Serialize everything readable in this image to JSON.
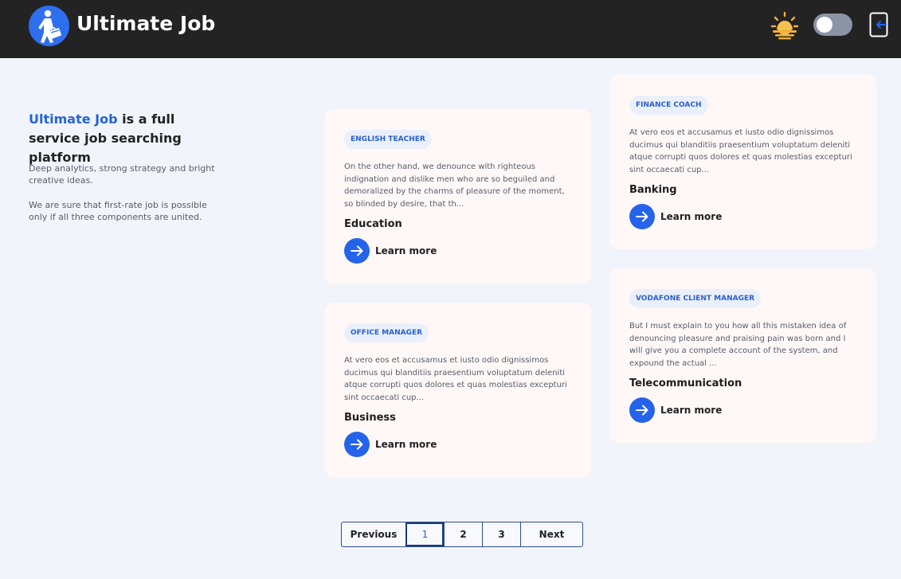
{
  "header": {
    "brand": "Ultimate Job",
    "logo_icon": "worker-with-briefcase-icon",
    "theme_icon": "sunrise-icon",
    "toggle_state": "off",
    "logout_icon": "logout-icon"
  },
  "intro": {
    "brand_highlight": "Ultimate Job",
    "title_rest": " is a full service job searching platform",
    "paragraph1": "Deep analytics, strong strategy and bright creative ideas.",
    "paragraph2": "We are sure that first-rate job is possible only if all three components are united."
  },
  "jobs": [
    {
      "title": "ENGLISH TEACHER",
      "description": "On the other hand, we denounce with righteous indignation and dislike men who are so beguiled and demoralized by the charms of pleasure of the moment, so blinded by desire, that th...",
      "category": "Education",
      "action": "Learn more"
    },
    {
      "title": "FINANCE COACH",
      "description": "At vero eos et accusamus et iusto odio dignissimos ducimus qui blanditiis praesentium voluptatum deleniti atque corrupti quos dolores et quas molestias excepturi sint occaecati cup...",
      "category": "Banking",
      "action": "Learn more"
    },
    {
      "title": "OFFICE MANAGER",
      "description": "At vero eos et accusamus et iusto odio dignissimos ducimus qui blanditiis praesentium voluptatum deleniti atque corrupti quos dolores et quas molestias excepturi sint occaecati cup...",
      "category": "Business",
      "action": "Learn more"
    },
    {
      "title": "VODAFONE CLIENT MANAGER",
      "description": "But I must explain to you how all this mistaken idea of denouncing pleasure and praising pain was born and I will give you a complete account of the system, and expound the actual ...",
      "category": "Telecommunication",
      "action": "Learn more"
    }
  ],
  "pagination": {
    "previous": "Previous",
    "pages": [
      "1",
      "2",
      "3"
    ],
    "current": "1",
    "next": "Next"
  },
  "colors": {
    "accent": "#2563eb",
    "header_bg": "#232323",
    "page_bg": "#f1f5fb",
    "card_bg": "#fff8f7"
  }
}
